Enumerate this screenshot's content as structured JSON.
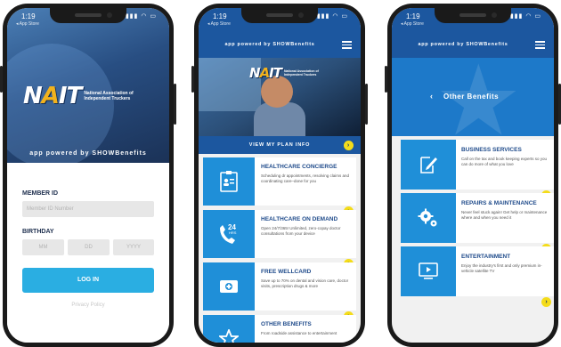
{
  "status": {
    "time": "1:19",
    "back_label": "◂ App Store"
  },
  "brand": {
    "mark_main": "N",
    "mark_dot": "A",
    "mark_end": "IT",
    "org_line1": "National Association of",
    "org_line2": "Independent Truckers",
    "powered": "app powered by SHOWBenefits"
  },
  "login": {
    "member_id_label": "MEMBER ID",
    "member_id_placeholder": "Member ID Number",
    "birthday_label": "BIRTHDAY",
    "mm": "MM",
    "dd": "DD",
    "yyyy": "YYYY",
    "login_button": "LOG IN",
    "privacy": "Privacy Policy"
  },
  "home": {
    "plan_bar": "VIEW MY PLAN INFO",
    "cards": [
      {
        "title": "HEALTHCARE CONCIERGE",
        "desc": "Scheduling dr appointments, resolving claims and coordinating care–done for you",
        "icon": "id-card-icon"
      },
      {
        "title": "HEALTHCARE ON DEMAND",
        "desc": "Open 24/7/365! Unlimited, zero-copay doctor consultations from your device",
        "icon": "phone-24hrs-icon",
        "icon_text_top": "24",
        "icon_text_bottom": "HRS"
      },
      {
        "title": "FREE WELLCARD",
        "desc": "Save up to 70% on dental and vision care, doctor visits, prescription drugs & more",
        "icon": "medical-card-icon"
      },
      {
        "title": "OTHER BENEFITS",
        "desc": "From roadside assistance to entertainment",
        "icon": "star-icon"
      }
    ]
  },
  "benefits": {
    "title": "Other Benefits",
    "cards": [
      {
        "title": "BUSINESS SERVICES",
        "desc": "Call on the tax and book keeping experts so you can do more of what you love",
        "icon": "document-pen-icon"
      },
      {
        "title": "REPAIRS & MAINTENANCE",
        "desc": "Never feel stuck again! Get help or maintenance where and when you need it",
        "icon": "gears-icon"
      },
      {
        "title": "ENTERTAINMENT",
        "desc": "Enjoy the industry's first and only premium in-vehicle satellite TV",
        "icon": "play-screen-icon"
      }
    ]
  },
  "colors": {
    "brand_blue": "#1c579f",
    "card_blue": "#1f8fd8",
    "login_blue": "#2aaee2",
    "arrow_yellow": "#f4dc1a",
    "gold": "#f2b21d"
  }
}
